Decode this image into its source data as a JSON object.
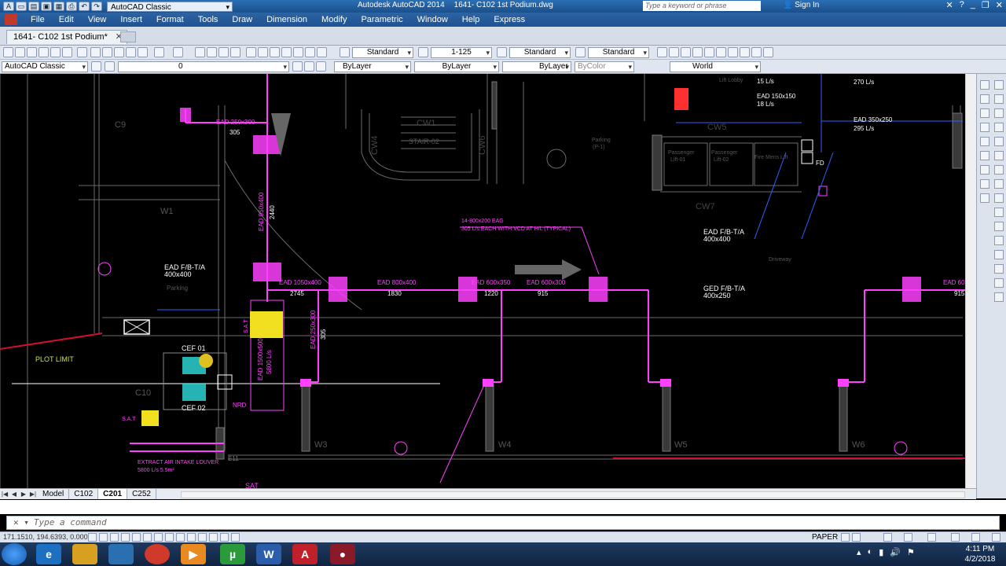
{
  "titlebar": {
    "workspace": "AutoCAD Classic",
    "app": "Autodesk AutoCAD 2014",
    "file": "1641- C102 1st Podium.dwg",
    "search_placeholder": "Type a keyword or phrase",
    "sign_in": "Sign In"
  },
  "menu": [
    "File",
    "Edit",
    "View",
    "Insert",
    "Format",
    "Tools",
    "Draw",
    "Dimension",
    "Modify",
    "Parametric",
    "Window",
    "Help",
    "Express"
  ],
  "file_tab": {
    "label": "1641- C102 1st Podium*",
    "close": "✕"
  },
  "toolbar": {
    "text_style": "Standard",
    "dim_scale": "1-125",
    "table_style": "Standard",
    "mleader_style": "Standard",
    "workspace": "AutoCAD Classic",
    "layer": "0",
    "color": "ByLayer",
    "linetype": "ByLayer",
    "lineweight": "ByLayer",
    "plotstyle": "ByColor",
    "ucs": "World"
  },
  "drawing": {
    "labels": {
      "ead250x300": "EAD 250x300",
      "ead250x300_v": "305",
      "ead950x400": "EAD 950x400",
      "ead950x400_v": "2440",
      "ead_fb_ta_1": "EAD F/B-T/A",
      "ead_fb_ta_1_size": "400x400",
      "cef01": "CEF 01",
      "cef02": "CEF 02",
      "plot_limit": "PLOT LIMIT",
      "sat": "S.A.T",
      "nrd": "NRD",
      "ead1500x500": "EAD 1500x500",
      "ead1500_flow": "5800 L/s",
      "ead1050x400": "EAD 1050x400",
      "ead1050_v": "2745",
      "ead800x400": "EAD 800x400",
      "ead800_v": "1830",
      "ead600x350": "EAD 600x350",
      "ead600x350_v": "1220",
      "ead600x300": "EAD 600x300",
      "ead600x300_v": "915",
      "ead250x300_b": "EAD 250x300",
      "v305": "305",
      "note1": "14-800x200 EAG",
      "note2": "305 L/s EACH WITH VCD AT H/L (TYPICAL)",
      "ead_fb_ta_2": "EAD F/B-T/A",
      "ead_fb_ta_2_size": "400x400",
      "ged_fb_ta": "GED F/B-T/A",
      "ged_fb_ta_size": "400x250",
      "ead150x150": "EAD 150x150",
      "flow18": "18 L/s",
      "flow15": "15 L/s",
      "flow270": "270 L/s",
      "ead350x250": "EAD 350x250",
      "flow295": "295 L/s",
      "stair": "STAIR-02",
      "cw1": "CW1",
      "cw4": "CW4",
      "cw5": "CW5",
      "cw6": "CW6",
      "cw7": "CW7",
      "c9": "C9",
      "c10": "C10",
      "w1": "W1",
      "w3": "W3",
      "w4": "W4",
      "w5": "W5",
      "w6": "W6",
      "parking1": "Parking",
      "parking2": "Parking",
      "passenger1": "Passenger",
      "lift1": "Lift-01",
      "passenger2": "Passenger",
      "lift2": "Lift-02",
      "firemen": "Fire Mens Lift",
      "lift_lobby": "Lift Lobby",
      "fd": "FD",
      "extract": "EXTRACT AIR INTAKE LOUVER",
      "extract_flow": "5800 L/s 5.5m²",
      "driveway": "Driveway",
      "e11": "E11",
      "sat2": "SAT",
      "sat3": "S.A.T",
      "ead_right": "EAD 60",
      "v915": "915",
      "parking_sub": "(P-1)"
    }
  },
  "layout_tabs": [
    "Model",
    "C102",
    "C201",
    "C252"
  ],
  "active_layout": "C201",
  "command": {
    "placeholder": "Type a command"
  },
  "status": {
    "coords": "171.1510, 194.6393, 0.0000",
    "paper": "PAPER"
  },
  "clock": {
    "time": "4:11 PM",
    "date": "4/2/2018"
  }
}
